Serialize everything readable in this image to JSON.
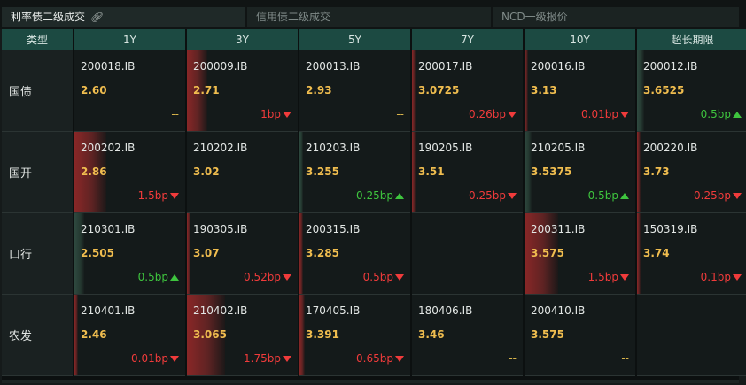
{
  "tabs": [
    {
      "label": "利率债二级成交",
      "active": true,
      "icon": "link-icon"
    },
    {
      "label": "信用债二级成交",
      "active": false
    },
    {
      "label": "NCD一级报价",
      "active": false
    }
  ],
  "columns": [
    "类型",
    "1Y",
    "3Y",
    "5Y",
    "7Y",
    "10Y",
    "超长期限"
  ],
  "colors": {
    "up": "#3ec43e",
    "down": "#f03b3b",
    "price": "#f0bd4f",
    "header": "#1c4a42"
  },
  "rows": [
    {
      "label": "国债",
      "cells": [
        {
          "code": "200018.IB",
          "price": "2.60",
          "change": "--",
          "dir": "flat",
          "bar": null,
          "strength": 0
        },
        {
          "code": "200009.IB",
          "price": "2.71",
          "change": "1bp",
          "dir": "down",
          "bar": "red",
          "strength": 0.18
        },
        {
          "code": "200013.IB",
          "price": "2.93",
          "change": "--",
          "dir": "flat",
          "bar": null,
          "strength": 0
        },
        {
          "code": "200017.IB",
          "price": "3.0725",
          "change": "0.26bp",
          "dir": "down",
          "bar": "red",
          "strength": 0.03
        },
        {
          "code": "200016.IB",
          "price": "3.13",
          "change": "0.01bp",
          "dir": "down",
          "bar": "red",
          "strength": 0.01
        },
        {
          "code": "200012.IB",
          "price": "3.6525",
          "change": "0.5bp",
          "dir": "up",
          "bar": "green",
          "strength": 0.06
        }
      ]
    },
    {
      "label": "国开",
      "cells": [
        {
          "code": "200202.IB",
          "price": "2.86",
          "change": "1.5bp",
          "dir": "down",
          "bar": "red",
          "strength": 0.29
        },
        {
          "code": "210202.IB",
          "price": "3.02",
          "change": "--",
          "dir": "flat",
          "bar": null,
          "strength": 0
        },
        {
          "code": "210203.IB",
          "price": "3.255",
          "change": "0.25bp",
          "dir": "up",
          "bar": "green",
          "strength": 0.03
        },
        {
          "code": "190205.IB",
          "price": "3.51",
          "change": "0.25bp",
          "dir": "down",
          "bar": "red",
          "strength": 0.03
        },
        {
          "code": "210205.IB",
          "price": "3.5375",
          "change": "0.5bp",
          "dir": "up",
          "bar": "green",
          "strength": 0.06
        },
        {
          "code": "200220.IB",
          "price": "3.73",
          "change": "0.25bp",
          "dir": "down",
          "bar": "red",
          "strength": 0.03
        }
      ]
    },
    {
      "label": "口行",
      "cells": [
        {
          "code": "210301.IB",
          "price": "2.505",
          "change": "0.5bp",
          "dir": "up",
          "bar": "green",
          "strength": 0.09
        },
        {
          "code": "190305.IB",
          "price": "3.07",
          "change": "0.52bp",
          "dir": "down",
          "bar": "red",
          "strength": 0.03
        },
        {
          "code": "200315.IB",
          "price": "3.285",
          "change": "0.5bp",
          "dir": "down",
          "bar": "red",
          "strength": 0.02
        },
        null,
        {
          "code": "200311.IB",
          "price": "3.575",
          "change": "1.5bp",
          "dir": "down",
          "bar": "red",
          "strength": 0.3
        },
        {
          "code": "150319.IB",
          "price": "3.74",
          "change": "0.1bp",
          "dir": "down",
          "bar": "red",
          "strength": 0.01
        }
      ]
    },
    {
      "label": "农发",
      "cells": [
        {
          "code": "210401.IB",
          "price": "2.46",
          "change": "0.01bp",
          "dir": "down",
          "bar": "red",
          "strength": 0.01
        },
        {
          "code": "210402.IB",
          "price": "3.065",
          "change": "1.75bp",
          "dir": "down",
          "bar": "red",
          "strength": 0.34
        },
        {
          "code": "170405.IB",
          "price": "3.391",
          "change": "0.65bp",
          "dir": "down",
          "bar": "red",
          "strength": 0.05
        },
        {
          "code": "180406.IB",
          "price": "3.46",
          "change": "--",
          "dir": "flat",
          "bar": null,
          "strength": 0
        },
        {
          "code": "200410.IB",
          "price": "3.575",
          "change": "--",
          "dir": "flat",
          "bar": null,
          "strength": 0
        },
        null
      ]
    }
  ]
}
